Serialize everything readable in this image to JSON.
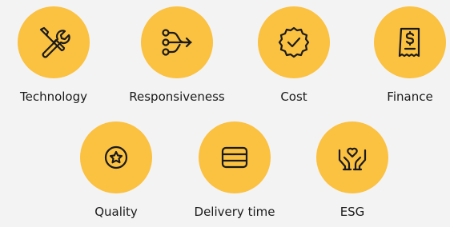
{
  "colors": {
    "background": "#f3f3f3",
    "circle": "#fbc140",
    "icon_stroke": "#1a1a1a",
    "text": "#1a1a1a"
  },
  "items": [
    {
      "label": "Technology",
      "icon": "tools-icon"
    },
    {
      "label": "Responsiveness",
      "icon": "split-arrows-icon"
    },
    {
      "label": "Cost",
      "icon": "badge-check-icon"
    },
    {
      "label": "Finance",
      "icon": "receipt-dollar-icon"
    },
    {
      "label": "Quality",
      "icon": "star-circle-icon"
    },
    {
      "label": "Delivery time",
      "icon": "card-icon"
    },
    {
      "label": "ESG",
      "icon": "hands-heart-icon"
    }
  ]
}
